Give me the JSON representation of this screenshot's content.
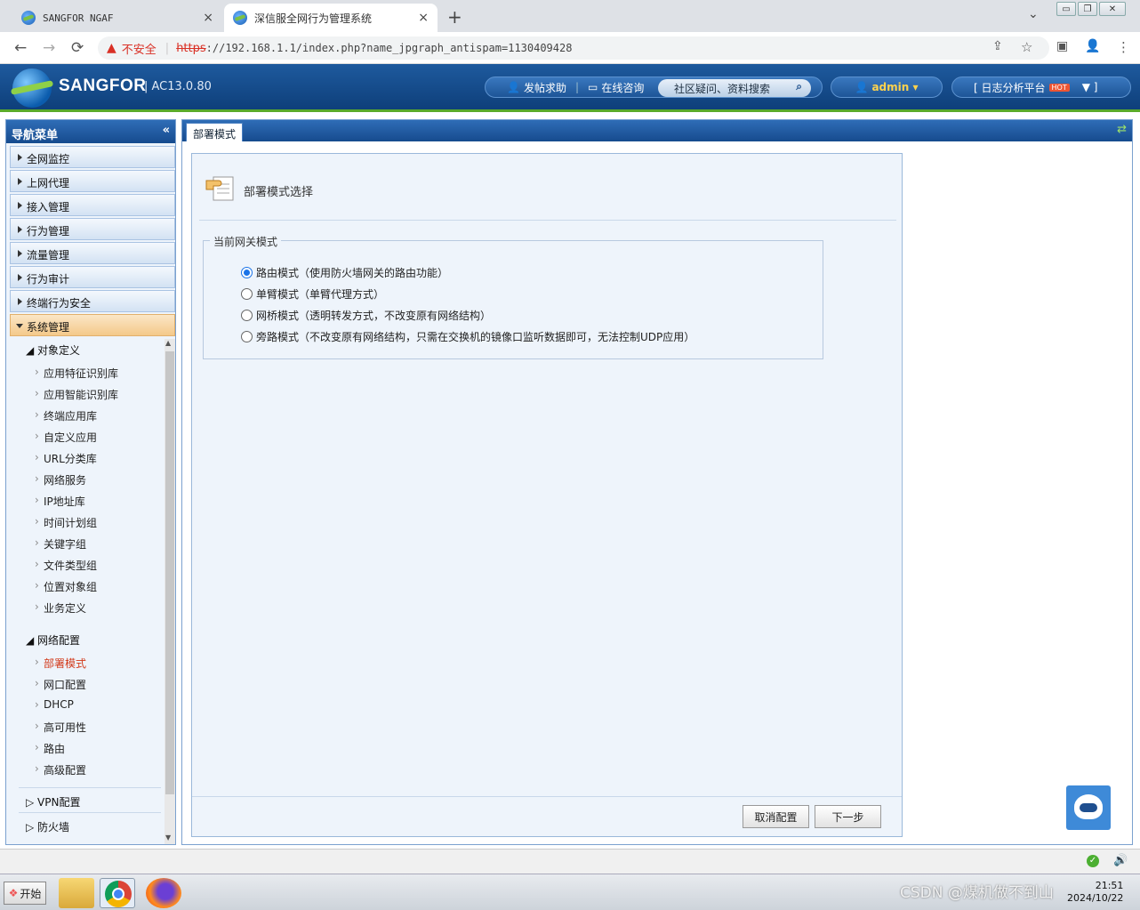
{
  "browser": {
    "tabs": [
      {
        "title": "SANGFOR NGAF",
        "close": "×"
      },
      {
        "title": "深信服全网行为管理系统",
        "close": "×"
      }
    ],
    "new_tab": "+",
    "tab_search": "⌄",
    "win_controls": [
      "▭",
      "❐",
      "✕"
    ],
    "nav": {
      "back": "←",
      "forward": "→",
      "reload": "⟳"
    },
    "security_label": "不安全",
    "url_scheme": "https",
    "url_rest": "://192.168.1.1/index.php?name_jpgraph_antispam=1130409428",
    "right_icons": [
      "⇪",
      "☆",
      "▣",
      "👤",
      "⋮"
    ]
  },
  "app_header": {
    "brand": "SANGFOR",
    "version": "AC13.0.80",
    "help_link": "发帖求助",
    "consult_link": "在线咨询",
    "search_placeholder": "社区疑问、资料搜索",
    "user": "admin ▾",
    "log_platform": "[ 日志分析平台",
    "log_badge": "HOT",
    "log_caret": "▼   ]"
  },
  "nav": {
    "title": "导航菜单",
    "collapse": "«",
    "top_items": [
      "全网监控",
      "上网代理",
      "接入管理",
      "行为管理",
      "流量管理",
      "行为审计",
      "终端行为安全"
    ],
    "open_item": "系统管理",
    "group1": {
      "label": "对象定义",
      "items": [
        "应用特征识别库",
        "应用智能识别库",
        "终端应用库",
        "自定义应用",
        "URL分类库",
        "网络服务",
        "IP地址库",
        "时间计划组",
        "关键字组",
        "文件类型组",
        "位置对象组",
        "业务定义"
      ]
    },
    "group2": {
      "label": "网络配置",
      "items": [
        "部署模式",
        "网口配置",
        "DHCP",
        "高可用性",
        "路由",
        "高级配置"
      ]
    },
    "group3": {
      "label": "VPN配置"
    },
    "group4": {
      "label": "防火墙"
    }
  },
  "main": {
    "tab": "部署模式",
    "refresh_icon": "⇄",
    "section_title": "部署模式选择",
    "fieldset_legend": "当前网关模式",
    "modes": [
      {
        "label": "路由模式（使用防火墙网关的路由功能）",
        "checked": true
      },
      {
        "label": "单臂模式（单臂代理方式）",
        "checked": false
      },
      {
        "label": "网桥模式（透明转发方式，不改变原有网络结构）",
        "checked": false
      },
      {
        "label": "旁路模式（不改变原有网络结构，只需在交换机的镜像口监听数据即可，无法控制UDP应用）",
        "checked": false
      }
    ],
    "cancel_button": "取消配置",
    "next_button": "下一步"
  },
  "taskbar": {
    "start": "开始",
    "clock_time": "21:51",
    "clock_date": "2024/10/22",
    "watermark": "CSDN @煤机做不到山"
  }
}
